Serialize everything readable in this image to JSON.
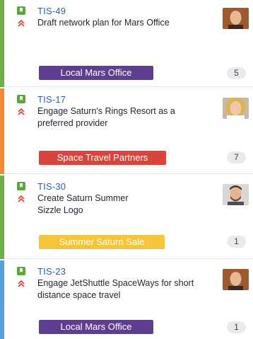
{
  "cards": [
    {
      "key": "TIS-49",
      "summary": "Draft network plan for Mars Office",
      "epic": "Local Mars Office",
      "count": "5",
      "stripe_color": "#6fae4b",
      "epic_bg": "#5e3f8f",
      "epic_fg": "#ffffff",
      "issue_type_icon": "story-icon",
      "priority_icon": "priority-highest-icon",
      "avatar": "man-red-hair-avatar"
    },
    {
      "key": "TIS-17",
      "summary": "Engage Saturn's Rings Resort as a preferred provider",
      "epic": "Space Travel Partners",
      "count": "7",
      "stripe_color": "#ef8b33",
      "epic_bg": "#d9453c",
      "epic_fg": "#ffffff",
      "issue_type_icon": "story-icon",
      "priority_icon": "priority-highest-icon",
      "avatar": "woman-blonde-avatar"
    },
    {
      "key": "TIS-30",
      "summary": "Create Saturn Summer Sizzle Logo",
      "epic": "Summer Saturn Sale",
      "count": "1",
      "stripe_color": "#6fae4b",
      "epic_bg": "#f4c43a",
      "epic_fg": "#ffffff",
      "issue_type_icon": "story-icon",
      "priority_icon": "priority-highest-icon",
      "avatar": "man-beard-avatar"
    },
    {
      "key": "TIS-23",
      "summary": "Engage JetShuttle SpaceWays for short distance space travel",
      "epic": "Local Mars Office",
      "count": "1",
      "stripe_color": "#5aa0d8",
      "epic_bg": "#5e3f8f",
      "epic_fg": "#ffffff",
      "issue_type_icon": "story-icon",
      "priority_icon": "priority-highest-icon",
      "avatar": "man-red-hair-avatar"
    }
  ]
}
